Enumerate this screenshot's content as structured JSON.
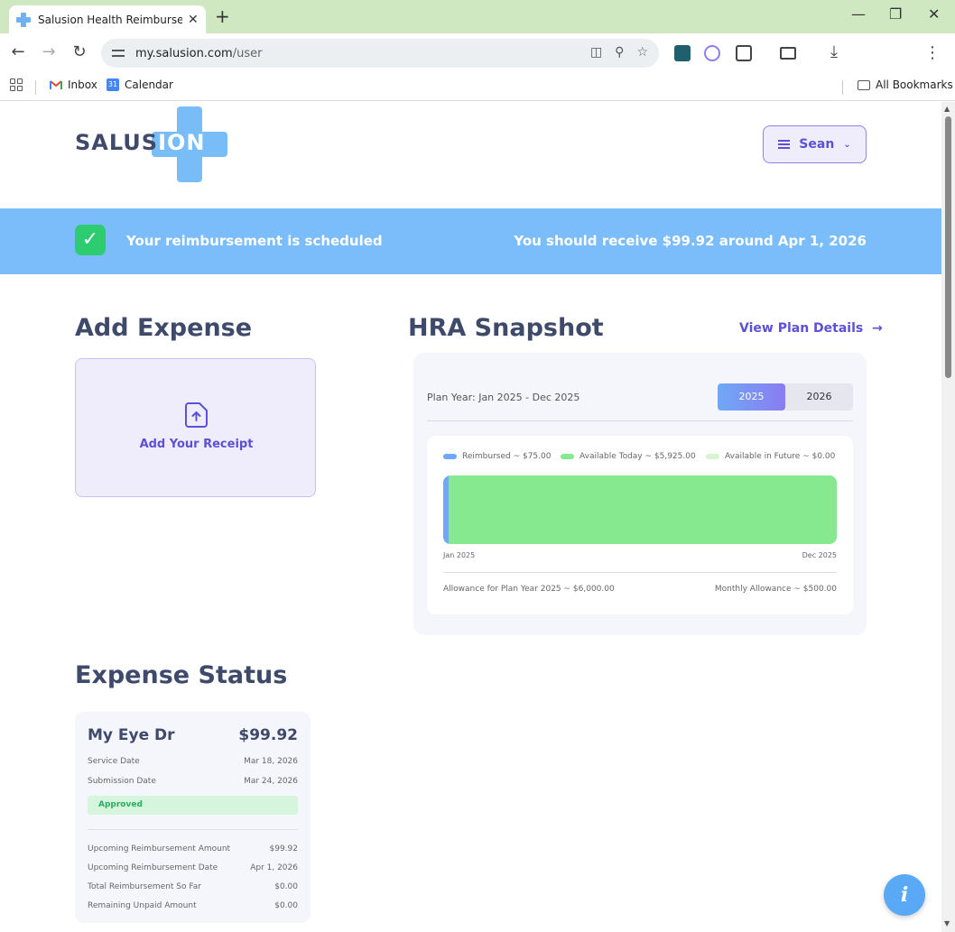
{
  "browser": {
    "tab_title": "Salusion Health Reimbursement",
    "tab_close": "✕",
    "new_tab": "+",
    "url_host": "my.salusion.com",
    "url_path": "/user",
    "bookmarks": [
      {
        "label": "Inbox"
      },
      {
        "label": "Calendar"
      }
    ],
    "all_bookmarks": "All Bookmarks",
    "calendar_day": "31"
  },
  "header": {
    "logo_text_a": "SALUS",
    "logo_text_b": "ION",
    "user_name": "Sean"
  },
  "banner": {
    "message": "Your reimbursement is scheduled",
    "detail": "You should receive $99.92 around Apr 1, 2026"
  },
  "add_expense": {
    "title": "Add Expense",
    "receipt_label": "Add Your Receipt"
  },
  "snapshot": {
    "title": "HRA Snapshot",
    "view_plan": "View Plan Details",
    "plan_year_label": "Plan Year:  Jan 2025 - Dec 2025",
    "years": [
      "2025",
      "2026"
    ],
    "active_year": "2025"
  },
  "chart_data": {
    "type": "bar",
    "orientation": "horizontal-stacked",
    "series": [
      {
        "name": "Reimbursed ~ $75.00",
        "value": 75.0,
        "color": "#6fa8f6"
      },
      {
        "name": "Available Today ~ $5,925.00",
        "value": 5925.0,
        "color": "#86e88f"
      },
      {
        "name": "Available in Future ~ $0.00",
        "value": 0.0,
        "color": "#d8f5cf"
      }
    ],
    "total": 6000.0,
    "x_start_label": "Jan 2025",
    "x_end_label": "Dec 2025",
    "allowance_label": "Allowance for Plan Year 2025 ~ $6,000.00",
    "monthly_label": "Monthly Allowance ~ $500.00"
  },
  "expense_status": {
    "title": "Expense Status",
    "card": {
      "name": "My Eye Dr",
      "amount": "$99.92",
      "rows_top": [
        {
          "label": "Service Date",
          "value": "Mar 18, 2026"
        },
        {
          "label": "Submission Date",
          "value": "Mar 24, 2026"
        }
      ],
      "status": "Approved",
      "rows_bottom": [
        {
          "label": "Upcoming Reimbursement Amount",
          "value": "$99.92"
        },
        {
          "label": "Upcoming Reimbursement Date",
          "value": "Apr 1, 2026"
        },
        {
          "label": "Total Reimbursement So Far",
          "value": "$0.00"
        },
        {
          "label": "Remaining Unpaid Amount",
          "value": "$0.00"
        }
      ]
    }
  },
  "info_button": "i",
  "colors": {
    "brand_dark": "#3f4a6b",
    "accent_purple": "#5b50d6",
    "banner_blue": "#7bbcfa",
    "success_green": "#2ecc71"
  }
}
